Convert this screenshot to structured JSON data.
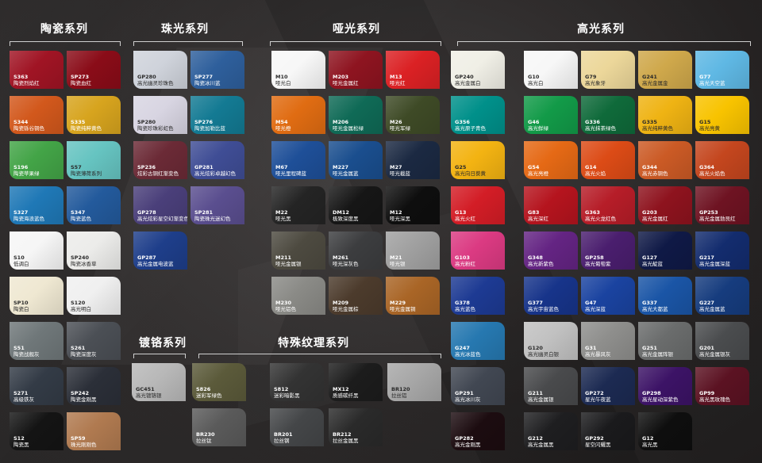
{
  "headers": {
    "ceramic": "陶瓷系列",
    "pearl": "珠光系列",
    "matte": "哑光系列",
    "gloss": "高光系列",
    "chrome": "镀铬系列",
    "texture": "特殊纹理系列"
  },
  "groups": [
    {
      "id": "ceramic",
      "columns": [
        [
          {
            "code": "S363",
            "name": "陶瓷烈焰红",
            "color": "#a01424"
          },
          {
            "code": "S344",
            "name": "陶瓷铄谷铜色",
            "color": "#d2581c"
          },
          {
            "code": "S196",
            "name": "陶瓷苹果绿",
            "color": "#43a447"
          },
          {
            "code": "S327",
            "name": "陶瓷海浪蓝色",
            "color": "#1f78b6"
          },
          {
            "code": "S10",
            "name": "低调白",
            "color": "#f6f6f6"
          },
          {
            "code": "SP10",
            "name": "陶瓷白",
            "color": "#efe8d2"
          },
          {
            "code": "S51",
            "name": "陶瓷战舰灰",
            "color": "#6f7779"
          },
          {
            "code": "S271",
            "name": "高级铁灰",
            "color": "#333b46"
          },
          {
            "code": "S12",
            "name": "陶瓷黑",
            "color": "#141414"
          }
        ],
        [
          {
            "code": "SP273",
            "name": "陶瓷血红",
            "color": "#8a0c18"
          },
          {
            "code": "S335",
            "name": "陶瓷纯粹黄色",
            "color": "#d7a41e"
          },
          {
            "code": "S57",
            "name": "陶瓷薄荷系列",
            "color": "#66c4c1"
          },
          {
            "code": "S347",
            "name": "陶瓷蓝色",
            "color": "#235a9c"
          },
          {
            "code": "SP240",
            "name": "陶瓷冰香草",
            "color": "#ececea"
          },
          {
            "code": "S120",
            "name": "高光明白",
            "color": "#f0f0f0"
          },
          {
            "code": "S261",
            "name": "陶瓷深度灰",
            "color": "#4b4f55"
          },
          {
            "code": "SP242",
            "name": "陶瓷金刚黑",
            "color": "#2b2f38"
          },
          {
            "code": "SP59",
            "name": "珠光刚刚色",
            "color": "#b07a50"
          }
        ]
      ]
    },
    {
      "id": "pearl",
      "columns": [
        [
          {
            "code": "GP280",
            "name": "高光幽灵珍珠色",
            "color": "#cfd3db"
          },
          {
            "code": "SP280",
            "name": "陶瓷珍珠彩虹色",
            "color": "#d8d5e2"
          },
          {
            "code": "SP236",
            "name": "炫彩古铜红渐变色",
            "color": "#6b2a36"
          },
          {
            "code": "GP278",
            "name": "高光炫彩星空幻渐变色",
            "color": "#4a3f7a"
          },
          {
            "code": "GP287",
            "name": "高光金属电波蓝",
            "color": "#1e3e8a"
          }
        ],
        [
          {
            "code": "SP277",
            "name": "陶瓷冰川蓝",
            "color": "#2e5f9c"
          },
          {
            "code": "SP276",
            "name": "陶瓷加勒比蓝",
            "color": "#137a93"
          },
          {
            "code": "GP281",
            "name": "高光炫彩卓越幻色",
            "color": "#3f4d95"
          },
          {
            "code": "SP281",
            "name": "陶瓷珠光迷幻色",
            "color": "#5a4e8f"
          }
        ]
      ]
    },
    {
      "id": "matte",
      "columns": [
        [
          {
            "code": "M10",
            "name": "哑光白",
            "color": "#f7f7f7"
          },
          {
            "code": "M54",
            "name": "哑光橙",
            "color": "#e06c12"
          },
          {
            "code": "M67",
            "name": "哑光里程碑蓝",
            "color": "#1e4f98"
          },
          {
            "code": "M22",
            "name": "哑光黑",
            "color": "#242424"
          },
          {
            "code": "M211",
            "name": "哑光金属银",
            "color": "#4d4a40"
          },
          {
            "code": "M230",
            "name": "哑光铝色",
            "color": "#8a8a86"
          }
        ],
        [
          {
            "code": "M203",
            "name": "哑光金属红",
            "color": "#8e1420"
          },
          {
            "code": "M206",
            "name": "哑光金属松绿",
            "color": "#0f6a56"
          },
          {
            "code": "M227",
            "name": "哑光金属蓝",
            "color": "#1a4e8e"
          },
          {
            "code": "DM12",
            "name": "极致深度黑",
            "color": "#161616"
          },
          {
            "code": "M261",
            "name": "哑光深灰色",
            "color": "#3c3d3f"
          },
          {
            "code": "M209",
            "name": "哑光金属棕",
            "color": "#4c3b2c"
          }
        ],
        [
          {
            "code": "M13",
            "name": "哑光红",
            "color": "#db2124"
          },
          {
            "code": "M26",
            "name": "哑光军绿",
            "color": "#3e4a26"
          },
          {
            "code": "M27",
            "name": "哑光截蓝",
            "color": "#1b2942"
          },
          {
            "code": "M12",
            "name": "哑光深黑",
            "color": "#0e0e0e"
          },
          {
            "code": "M21",
            "name": "哑光银",
            "color": "#a0a0a0"
          },
          {
            "code": "M229",
            "name": "哑光金属铜",
            "color": "#a96526"
          }
        ]
      ]
    },
    {
      "id": "gloss-a",
      "columns": [
        [
          {
            "code": "GP240",
            "name": "高光金属白",
            "color": "#f0efe6"
          },
          {
            "code": "G356",
            "name": "高光原子青色",
            "color": "#00908a"
          },
          {
            "code": "G25",
            "name": "高光向日葵黄",
            "color": "#f3b312"
          },
          {
            "code": "G13",
            "name": "高光火红",
            "color": "#d31d26"
          },
          {
            "code": "G103",
            "name": "高光粉红",
            "color": "#db3a82"
          },
          {
            "code": "G378",
            "name": "高光蓝色",
            "color": "#1d3a93"
          },
          {
            "code": "G247",
            "name": "高光冰蓝色",
            "color": "#2678b0"
          },
          {
            "code": "GP291",
            "name": "高光冰川灰",
            "color": "#414752"
          },
          {
            "code": "GP282",
            "name": "高光金刚黑",
            "color": "#1c0c10"
          }
        ]
      ]
    },
    {
      "id": "gloss-b",
      "columns": [
        [
          {
            "code": "G10",
            "name": "高光白",
            "color": "#f7f7f7"
          },
          {
            "code": "G46",
            "name": "高光鲜绿",
            "color": "#129a48"
          },
          {
            "code": "G54",
            "name": "高光亮橙",
            "color": "#e56915"
          },
          {
            "code": "G83",
            "name": "高光深红",
            "color": "#b5141e"
          },
          {
            "code": "G348",
            "name": "高光新紫色",
            "color": "#642483"
          },
          {
            "code": "G377",
            "name": "高光宇宙蓝色",
            "color": "#17348a"
          },
          {
            "code": "G120",
            "name": "高光幽灵白银",
            "color": "#c1c1c1"
          },
          {
            "code": "G211",
            "name": "高光金属银",
            "color": "#494a4c"
          },
          {
            "code": "G212",
            "name": "高光金属黑",
            "color": "#1e1e20"
          }
        ],
        [
          {
            "code": "G79",
            "name": "高光象牙",
            "color": "#ecd79a"
          },
          {
            "code": "G336",
            "name": "高光抹茶绿色",
            "color": "#0f6a3a"
          },
          {
            "code": "G14",
            "name": "高光火焰",
            "color": "#dc4b16"
          },
          {
            "code": "G363",
            "name": "高光火龙红色",
            "color": "#b61d28"
          },
          {
            "code": "GP258",
            "name": "高光葡萄紫",
            "color": "#4a1e6e"
          },
          {
            "code": "G47",
            "name": "高光深蓝",
            "color": "#1a43a0"
          },
          {
            "code": "G31",
            "name": "高光暴风灰",
            "color": "#8e8e8c"
          },
          {
            "code": "GP272",
            "name": "星光午夜蓝",
            "color": "#1c2a52"
          },
          {
            "code": "GP292",
            "name": "星空闪耀黑",
            "color": "#1a1a1c"
          }
        ],
        [
          {
            "code": "G241",
            "name": "高光金属金",
            "color": "#cfa84b"
          },
          {
            "code": "G335",
            "name": "高光纯粹黄色",
            "color": "#efb313"
          },
          {
            "code": "G344",
            "name": "高光赤铜色",
            "color": "#cb5a25"
          },
          {
            "code": "G203",
            "name": "高光金属红",
            "color": "#8e131e"
          },
          {
            "code": "G127",
            "name": "高光靛蓝",
            "color": "#0f1946"
          },
          {
            "code": "G337",
            "name": "高光大都蓝",
            "color": "#1a55a6"
          },
          {
            "code": "G251",
            "name": "高光金属阵银",
            "color": "#6a6c6c"
          },
          {
            "code": "GP298",
            "name": "高光星动深紫色",
            "color": "#3c1366"
          },
          {
            "code": "G12",
            "name": "高光黑",
            "color": "#0e0e0e"
          }
        ],
        [
          {
            "code": "G77",
            "name": "高光天空蓝",
            "color": "#5fb8e4"
          },
          {
            "code": "G15",
            "name": "高光亮黄",
            "color": "#f8c300"
          },
          {
            "code": "G364",
            "name": "高光火焰色",
            "color": "#c4461e"
          },
          {
            "code": "GP253",
            "name": "高光金属勃艮红",
            "color": "#6e1322"
          },
          {
            "code": "G217",
            "name": "高光金属深蓝",
            "color": "#132c6e"
          },
          {
            "code": "G227",
            "name": "高光金属蓝",
            "color": "#163c7e"
          },
          {
            "code": "G201",
            "name": "高光金属银灰",
            "color": "#4a4c4e"
          },
          {
            "code": "GP99",
            "name": "高光黑玫瑰色",
            "color": "#5b1222"
          }
        ]
      ]
    },
    {
      "id": "chrome",
      "columns": [
        [
          {
            "code": "GC451",
            "name": "高光镀铬银",
            "color": "#b8b8b8"
          }
        ]
      ]
    },
    {
      "id": "texture",
      "columns": [
        [
          {
            "code": "S826",
            "name": "迷彩军绿色",
            "color": "#5b5a3a"
          },
          {
            "code": "BR230",
            "name": "拉丝钛",
            "color": "#5a5a5a"
          }
        ],
        [
          {
            "code": "S812",
            "name": "迷彩暗影黑",
            "color": "#333333"
          },
          {
            "code": "BR201",
            "name": "拉丝钢",
            "color": "#444648"
          }
        ],
        [
          {
            "code": "MX12",
            "name": "质感碳纤黑",
            "color": "#1c1c1c"
          },
          {
            "code": "BR212",
            "name": "拉丝金属黑",
            "color": "#2a2a2a"
          }
        ],
        [
          {
            "code": "BR120",
            "name": "拉丝铝",
            "color": "#a7a7a7"
          }
        ]
      ]
    }
  ]
}
